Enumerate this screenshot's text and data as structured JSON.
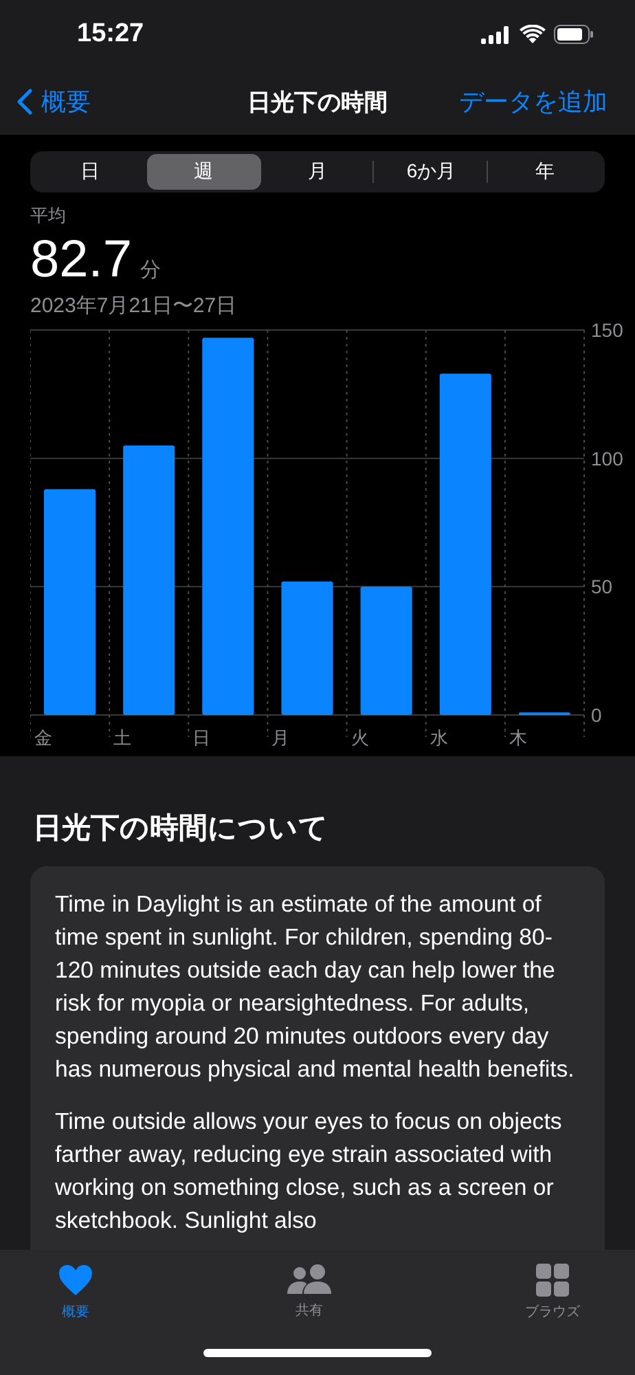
{
  "status_bar": {
    "time": "15:27"
  },
  "nav": {
    "back": "概要",
    "title": "日光下の時間",
    "action": "データを追加"
  },
  "periods": [
    {
      "label": "日",
      "selected": false
    },
    {
      "label": "週",
      "selected": true
    },
    {
      "label": "月",
      "selected": false
    },
    {
      "label": "6か月",
      "selected": false
    },
    {
      "label": "年",
      "selected": false
    }
  ],
  "summary": {
    "label": "平均",
    "value": "82.7",
    "unit": "分",
    "range": "2023年7月21日〜27日"
  },
  "chart_data": {
    "type": "bar",
    "categories": [
      "金",
      "土",
      "日",
      "月",
      "火",
      "水",
      "木"
    ],
    "series": [
      {
        "color": "#0a84ff",
        "values": [
          88,
          105,
          147,
          52,
          50,
          133,
          1
        ]
      }
    ],
    "ylim": [
      0,
      150
    ],
    "yticks": [
      0,
      50,
      100,
      150
    ]
  },
  "about": {
    "heading": "日光下の時間について",
    "paragraphs": [
      "Time in Daylight is an estimate of the amount of time spent in sunlight. For children, spending 80-120 minutes outside each day can help lower the risk for myopia or nearsightedness. For adults, spending around 20 minutes outdoors every day has numerous physical and mental health benefits.",
      "Time outside allows your eyes to focus on objects farther away, reducing eye strain associated with working on something close, such as a screen or sketchbook. Sunlight also"
    ]
  },
  "tab_bar": [
    {
      "kind": "heart",
      "label": "概要",
      "selected": true
    },
    {
      "kind": "people",
      "label": "共有",
      "selected": false
    },
    {
      "kind": "grid",
      "label": "ブラウズ",
      "selected": false
    }
  ]
}
